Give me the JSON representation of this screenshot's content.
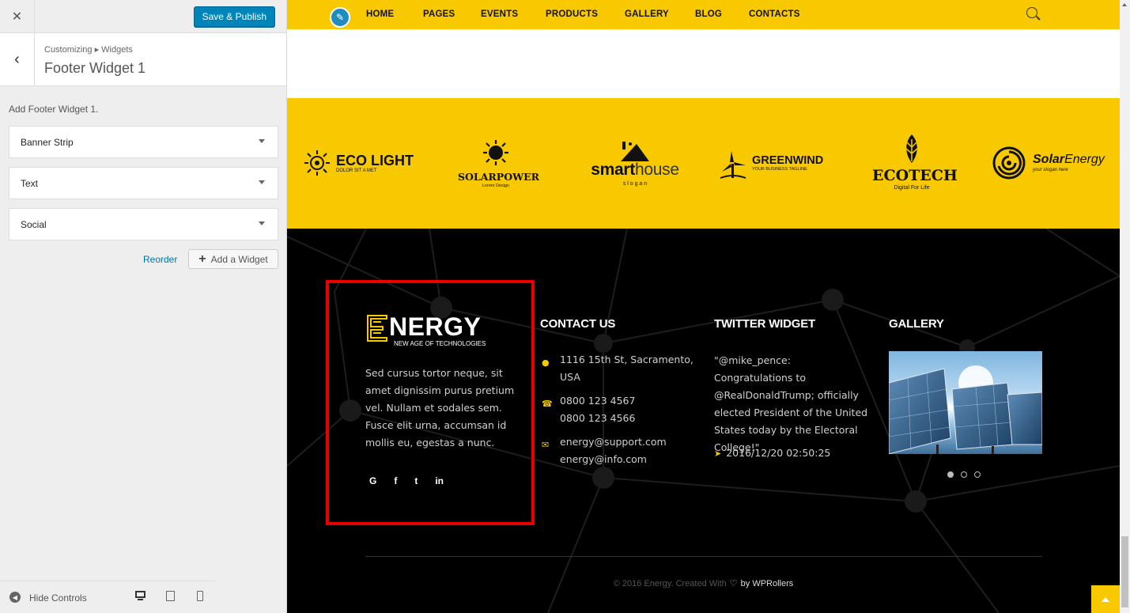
{
  "sidebar": {
    "close_label": "✕",
    "publish_label": "Save & Publish",
    "breadcrumb": "Customizing ▸ Widgets",
    "section_title": "Footer Widget 1",
    "description": "Add Footer Widget 1.",
    "widgets": [
      "Banner Strip",
      "Text",
      "Social"
    ],
    "reorder_label": "Reorder",
    "add_widget_label": "Add a Widget",
    "hide_controls_label": "Hide Controls",
    "devices": [
      "desktop-icon",
      "tablet-icon",
      "mobile-icon"
    ]
  },
  "preview": {
    "nav": [
      "HOME",
      "PAGES",
      "EVENTS",
      "PRODUCTS",
      "GALLERY",
      "BLOG",
      "CONTACTS"
    ],
    "brands": {
      "eco_light": {
        "name": "ECO LIGHT",
        "tag": "DOLOR SIT A MET"
      },
      "solarpower": {
        "name": "SOLARPOWER",
        "tag": "Lorem Design"
      },
      "smarthouse": {
        "name_a": "smart",
        "name_b": "house",
        "tag": "s l o g a n"
      },
      "greenwind": {
        "name": "GREENWIND",
        "tag": "YOUR BUSINESS TAGLINE"
      },
      "ecotech": {
        "name": "ECOTECH",
        "tag": "Digital For Life"
      },
      "solar_energy": {
        "name_a": "Solar",
        "name_b": "Energy",
        "tag": "your slogan here"
      }
    },
    "footer": {
      "brand": "NERGY",
      "brand_tagline": "NEW AGE OF TECHNOLOGIES",
      "about": "Sed cursus tortor neque, sit amet dignissim purus pretium vel. Nullam et sodales sem. Fusce elit urna, accumsan id mollis eu, egestas a nunc.",
      "social": [
        "G",
        "f",
        "t",
        "in"
      ],
      "contact_heading": "CONTACT US",
      "address_1": "1116 15th St, Sacramento,",
      "address_2": "USA",
      "phone_1": "0800 123 4567",
      "phone_2": "0800 123 4566",
      "email_1": "energy@support.com",
      "email_2": "energy@info.com",
      "twitter_heading": "TWITTER WIDGET",
      "tweet": "\"@mike_pence: Congratulations to @RealDonaldTrump; officially elected President of the United States today by the Electoral College!\"",
      "tweet_date": "2016/12/20 02:50:25",
      "gallery_heading": "GALLERY",
      "copyright": "© 2016 Energy. Created With",
      "copyright_by": "by WPRollers"
    },
    "colors": {
      "accent": "#f9c900",
      "highlight": "#e60000",
      "wp_blue": "#0085ba"
    }
  }
}
